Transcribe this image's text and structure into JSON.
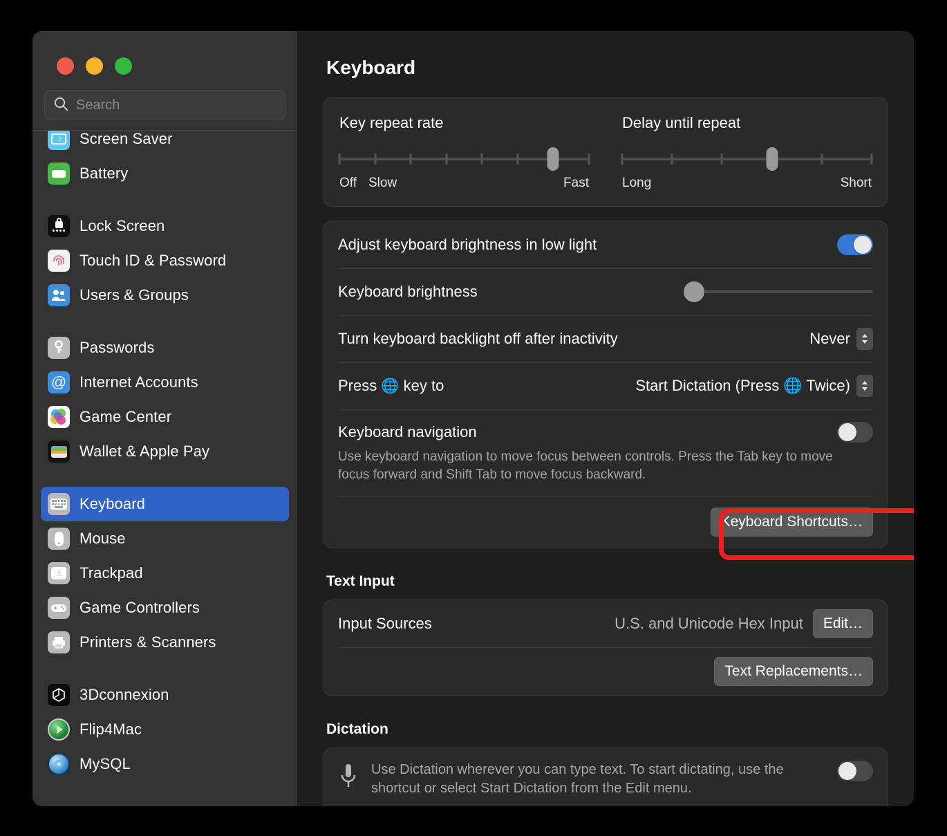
{
  "window": {
    "traffic_lights": [
      "close",
      "minimize",
      "zoom"
    ],
    "colors": {
      "accent_blue": "#3478d4",
      "selected_blue": "#2f62c4",
      "annotation_red": "#f41c1c",
      "sidebar_bg": "#333333",
      "detail_bg": "#1e1e1e",
      "card_bg": "#2a2a2a"
    }
  },
  "search": {
    "placeholder": "Search",
    "value": ""
  },
  "sidebar": {
    "groups": [
      {
        "items": [
          {
            "label": "Screen Saver",
            "icon": "screen-saver-icon",
            "selected": false
          },
          {
            "label": "Battery",
            "icon": "battery-icon",
            "selected": false
          }
        ]
      },
      {
        "items": [
          {
            "label": "Lock Screen",
            "icon": "lock-screen-icon",
            "selected": false
          },
          {
            "label": "Touch ID & Password",
            "icon": "touch-id-icon",
            "selected": false
          },
          {
            "label": "Users & Groups",
            "icon": "users-groups-icon",
            "selected": false
          }
        ]
      },
      {
        "items": [
          {
            "label": "Passwords",
            "icon": "passwords-key-icon",
            "selected": false
          },
          {
            "label": "Internet Accounts",
            "icon": "internet-accounts-at-icon",
            "selected": false
          },
          {
            "label": "Game Center",
            "icon": "game-center-icon",
            "selected": false
          },
          {
            "label": "Wallet & Apple Pay",
            "icon": "wallet-icon",
            "selected": false
          }
        ]
      },
      {
        "items": [
          {
            "label": "Keyboard",
            "icon": "keyboard-icon",
            "selected": true
          },
          {
            "label": "Mouse",
            "icon": "mouse-icon",
            "selected": false
          },
          {
            "label": "Trackpad",
            "icon": "trackpad-icon",
            "selected": false
          },
          {
            "label": "Game Controllers",
            "icon": "game-controller-icon",
            "selected": false
          },
          {
            "label": "Printers & Scanners",
            "icon": "printer-icon",
            "selected": false
          }
        ]
      },
      {
        "items": [
          {
            "label": "3Dconnexion",
            "icon": "3dconnexion-icon",
            "selected": false
          },
          {
            "label": "Flip4Mac",
            "icon": "flip4mac-icon",
            "selected": false
          },
          {
            "label": "MySQL",
            "icon": "mysql-icon",
            "selected": false
          }
        ]
      }
    ]
  },
  "detail": {
    "title": "Keyboard",
    "key_repeat": {
      "title": "Key repeat rate",
      "ticks": 8,
      "value_index": 6,
      "label_left_1": "Off",
      "label_left_2": "Slow",
      "label_right": "Fast"
    },
    "delay_until_repeat": {
      "title": "Delay until repeat",
      "ticks": 6,
      "value_index": 3,
      "label_left": "Long",
      "label_right": "Short"
    },
    "adjust_brightness": {
      "label": "Adjust keyboard brightness in low light",
      "toggle_on": true
    },
    "keyboard_brightness": {
      "label": "Keyboard brightness",
      "value_percent": 5
    },
    "backlight_off": {
      "label": "Turn keyboard backlight off after inactivity",
      "value": "Never"
    },
    "press_globe": {
      "label_before": "Press",
      "globe": "🌐",
      "label_after": "key to",
      "value": "Start Dictation (Press 🌐 Twice)"
    },
    "keyboard_navigation": {
      "label": "Keyboard navigation",
      "toggle_on": false,
      "description": "Use keyboard navigation to move focus between controls. Press the Tab key to move focus forward and Shift Tab to move focus backward."
    },
    "keyboard_shortcuts_button": "Keyboard Shortcuts…",
    "text_input": {
      "section_title": "Text Input",
      "input_sources_label": "Input Sources",
      "input_sources_value": "U.S. and Unicode Hex Input",
      "edit_button": "Edit…",
      "text_replacements_button": "Text Replacements…"
    },
    "dictation": {
      "section_title": "Dictation",
      "description": "Use Dictation wherever you can type text. To start dictating, use the shortcut or select Start Dictation from the Edit menu.",
      "toggle_on": false
    }
  }
}
